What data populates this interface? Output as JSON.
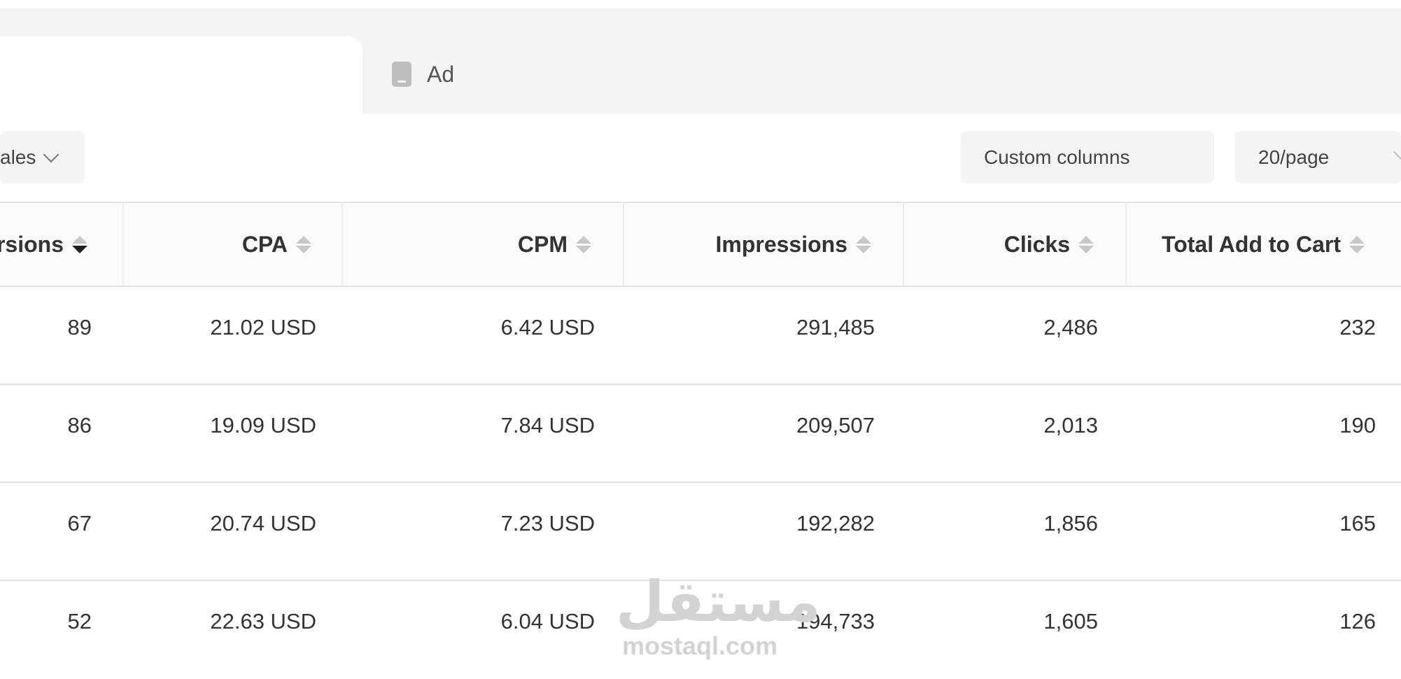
{
  "tabs": {
    "ad_label": "Ad"
  },
  "toolbar": {
    "filter_label": "ales",
    "custom_columns_label": "Custom columns",
    "page_size_label": "20/page"
  },
  "table": {
    "headers": [
      "rsions",
      "CPA",
      "CPM",
      "Impressions",
      "Clicks",
      "Total Add to Cart"
    ],
    "rows": [
      [
        "89",
        "21.02 USD",
        "6.42 USD",
        "291,485",
        "2,486",
        "232"
      ],
      [
        "86",
        "19.09 USD",
        "7.84 USD",
        "209,507",
        "2,013",
        "190"
      ],
      [
        "67",
        "20.74 USD",
        "7.23 USD",
        "192,282",
        "1,856",
        "165"
      ],
      [
        "52",
        "22.63 USD",
        "6.04 USD",
        "194,733",
        "1,605",
        "126"
      ]
    ]
  },
  "watermark": {
    "arabic": "مستقل",
    "latin": "mostaql.com"
  }
}
